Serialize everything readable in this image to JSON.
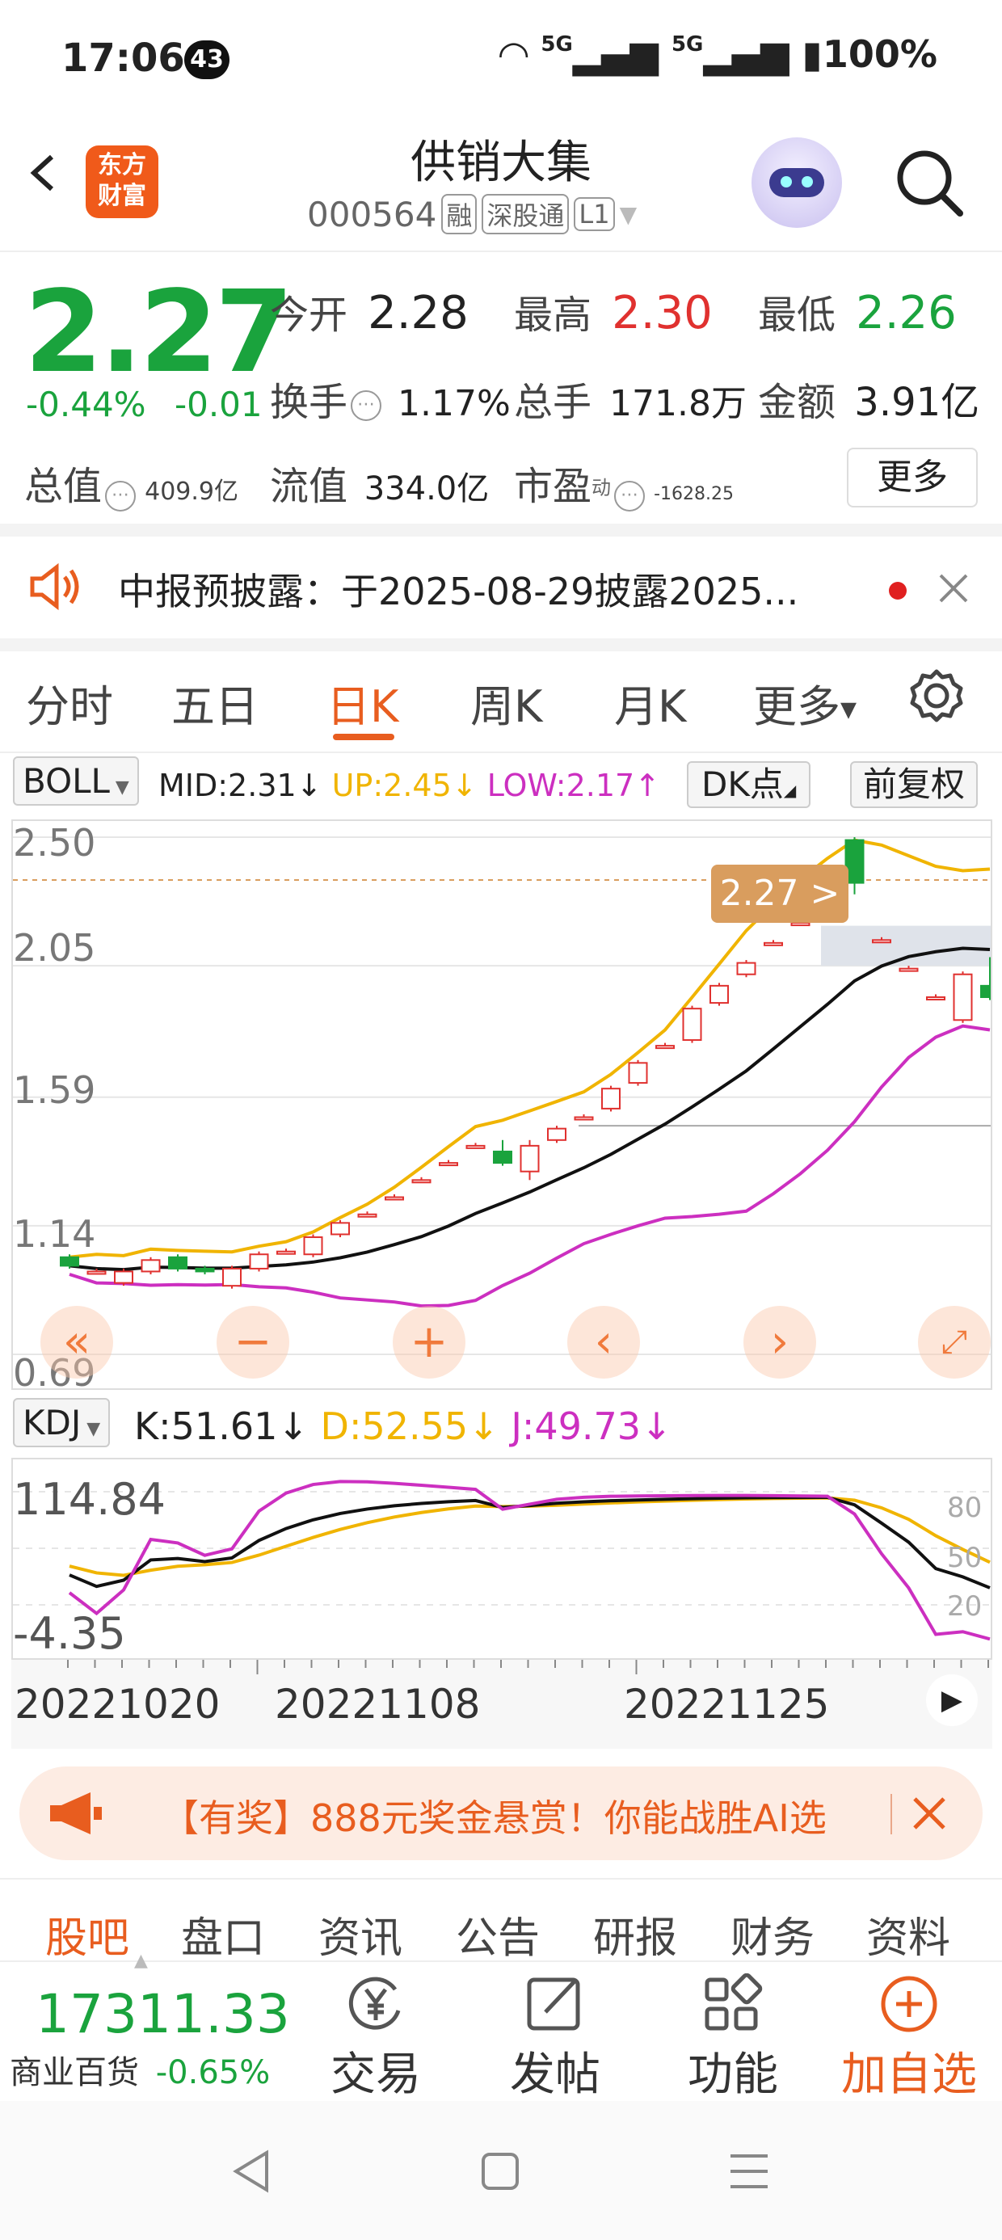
{
  "status_bar": {
    "time": "17:06",
    "notif_count": "43",
    "net1": "5G",
    "net2": "5G",
    "battery": "100%"
  },
  "header": {
    "title": "供销大集",
    "code": "000564",
    "tags": [
      "融",
      "深股通",
      "L1"
    ],
    "logo_line1": "东方",
    "logo_line2": "财富"
  },
  "quote": {
    "price": "2.27",
    "change_pct": "-0.44%",
    "change": "-0.01",
    "open_label": "今开",
    "open": "2.28",
    "high_label": "最高",
    "high": "2.30",
    "low_label": "最低",
    "low": "2.26",
    "turnover_label": "换手",
    "turnover": "1.17%",
    "volume_label": "总手",
    "volume": "171.8万",
    "amount_label": "金额",
    "amount": "3.91亿",
    "mktcap_label": "总值",
    "mktcap": "409.9亿",
    "float_label": "流值",
    "float": "334.0亿",
    "pe_label": "市盈",
    "pe_sup": "动",
    "pe": "-1628.25",
    "more": "更多"
  },
  "notice": {
    "text": "中报预披露：于2025-08-29披露2025..."
  },
  "tabs": [
    "分时",
    "五日",
    "日K",
    "周K",
    "月K",
    "更多"
  ],
  "active_tab": "日K",
  "boll": {
    "name": "BOLL",
    "mid": "MID:2.31↓",
    "up": "UP:2.45↓",
    "low": "LOW:2.17↑",
    "dk": "DK点",
    "adj": "前复权"
  },
  "kdj": {
    "name": "KDJ",
    "k": "K:51.61↓",
    "d": "D:52.55↓",
    "j": "J:49.73↓"
  },
  "colors": {
    "up": "#e0312f",
    "down": "#1aa33d",
    "mid": "#111111",
    "upper": "#f0b400",
    "lower": "#cc2fc0",
    "accent": "#e85d1f"
  },
  "chart_data": {
    "type": "candlestick",
    "y_ticks": [
      "2.50",
      "2.05",
      "1.59",
      "1.14",
      "0.69"
    ],
    "ylim": [
      0.69,
      2.5
    ],
    "price_tag": "2.27",
    "kdj_ticks": [
      "114.84",
      "-4.35"
    ],
    "kdj_right_ticks": [
      "80",
      "50",
      "20"
    ],
    "dates": [
      "20221020",
      "20221108",
      "20221125"
    ],
    "candles": [
      {
        "o": 1.03,
        "c": 1.0,
        "h": 1.04,
        "l": 0.99
      },
      {
        "o": 0.98,
        "c": 0.98,
        "h": 0.99,
        "l": 0.97
      },
      {
        "o": 0.94,
        "c": 0.98,
        "h": 0.99,
        "l": 0.93
      },
      {
        "o": 0.98,
        "c": 1.02,
        "h": 1.03,
        "l": 0.97
      },
      {
        "o": 1.03,
        "c": 0.99,
        "h": 1.04,
        "l": 0.98
      },
      {
        "o": 0.99,
        "c": 0.98,
        "h": 1.0,
        "l": 0.97
      },
      {
        "o": 0.93,
        "c": 0.99,
        "h": 1.0,
        "l": 0.92
      },
      {
        "o": 0.99,
        "c": 1.04,
        "h": 1.05,
        "l": 0.98
      },
      {
        "o": 1.05,
        "c": 1.05,
        "h": 1.06,
        "l": 1.04
      },
      {
        "o": 1.04,
        "c": 1.1,
        "h": 1.11,
        "l": 1.03
      },
      {
        "o": 1.11,
        "c": 1.15,
        "h": 1.16,
        "l": 1.1
      },
      {
        "o": 1.18,
        "c": 1.18,
        "h": 1.19,
        "l": 1.17
      },
      {
        "o": 1.24,
        "c": 1.24,
        "h": 1.25,
        "l": 1.23
      },
      {
        "o": 1.3,
        "c": 1.3,
        "h": 1.31,
        "l": 1.29
      },
      {
        "o": 1.36,
        "c": 1.36,
        "h": 1.37,
        "l": 1.35
      },
      {
        "o": 1.42,
        "c": 1.42,
        "h": 1.43,
        "l": 1.41
      },
      {
        "o": 1.4,
        "c": 1.36,
        "h": 1.44,
        "l": 1.35
      },
      {
        "o": 1.33,
        "c": 1.42,
        "h": 1.44,
        "l": 1.3
      },
      {
        "o": 1.44,
        "c": 1.48,
        "h": 1.49,
        "l": 1.43
      },
      {
        "o": 1.52,
        "c": 1.52,
        "h": 1.53,
        "l": 1.51
      },
      {
        "o": 1.55,
        "c": 1.62,
        "h": 1.63,
        "l": 1.54
      },
      {
        "o": 1.64,
        "c": 1.71,
        "h": 1.72,
        "l": 1.63
      },
      {
        "o": 1.77,
        "c": 1.77,
        "h": 1.78,
        "l": 1.76
      },
      {
        "o": 1.79,
        "c": 1.9,
        "h": 1.91,
        "l": 1.78
      },
      {
        "o": 1.92,
        "c": 1.98,
        "h": 1.99,
        "l": 1.91
      },
      {
        "o": 2.02,
        "c": 2.06,
        "h": 2.07,
        "l": 2.01
      },
      {
        "o": 2.13,
        "c": 2.13,
        "h": 2.14,
        "l": 2.12
      },
      {
        "o": 2.2,
        "c": 2.2,
        "h": 2.21,
        "l": 2.19
      },
      {
        "o": 2.26,
        "c": 2.26,
        "h": 2.27,
        "l": 2.25
      },
      {
        "o": 2.49,
        "c": 2.34,
        "h": 2.5,
        "l": 2.3
      },
      {
        "o": 2.14,
        "c": 2.14,
        "h": 2.15,
        "l": 2.13
      },
      {
        "o": 2.04,
        "c": 2.04,
        "h": 2.05,
        "l": 2.03
      },
      {
        "o": 1.94,
        "c": 1.94,
        "h": 1.95,
        "l": 1.93
      },
      {
        "o": 1.86,
        "c": 2.02,
        "h": 2.03,
        "l": 1.85
      },
      {
        "o": 1.98,
        "c": 1.94,
        "h": 2.08,
        "l": 1.93
      }
    ]
  },
  "ad": {
    "text": "【有奖】888元奖金悬赏！你能战胜AI选"
  },
  "bottom_tabs": [
    "股吧",
    "盘口",
    "资讯",
    "公告",
    "研报",
    "财务",
    "资料"
  ],
  "index": {
    "value": "17311.33",
    "name": "商业百货",
    "change": "-0.65%"
  },
  "actions": [
    "交易",
    "发帖",
    "功能",
    "加自选"
  ]
}
